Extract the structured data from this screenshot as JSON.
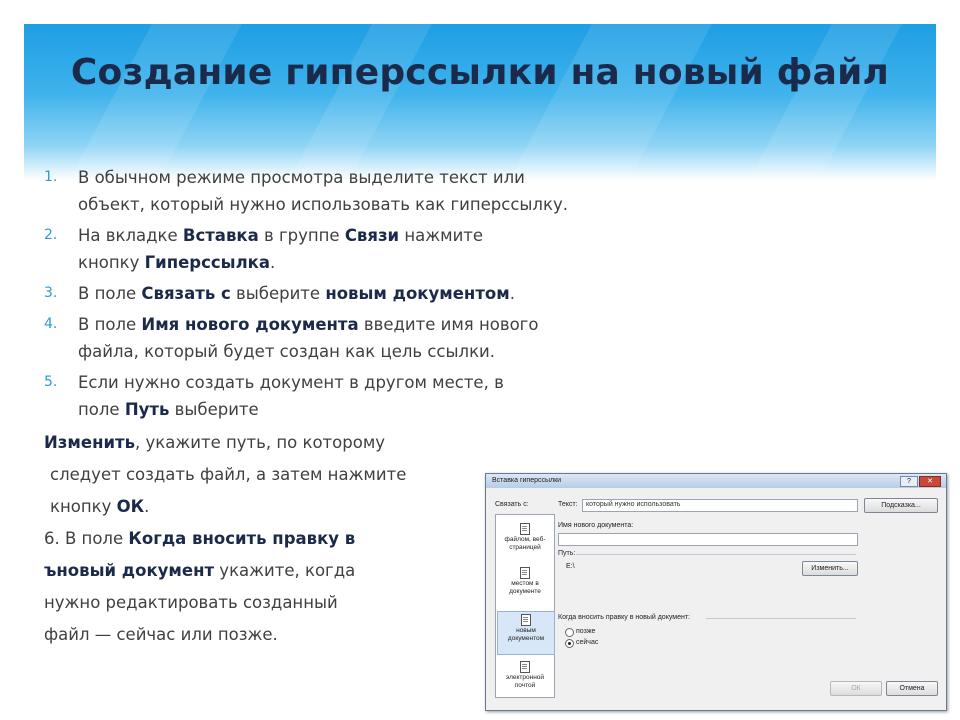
{
  "title": "Создание гиперссылки на новый файл",
  "steps": [
    {
      "num": "1.",
      "line1": "В обычном режиме просмотра выделите текст или",
      "line2": "объект, который нужно использовать как гиперссылку."
    },
    {
      "num": "2.",
      "p1": "На вкладке ",
      "b1": "Вставка",
      "p2": " в группе ",
      "b2": "Связи",
      "p3": " нажмите",
      "l2p": "кнопку ",
      "l2b": "Гиперссылка",
      "l2e": "."
    },
    {
      "num": "3.",
      "p1": "В поле ",
      "b1": "Связать с",
      "p2": " выберите ",
      "b2": "новым документом",
      "p3": "."
    },
    {
      "num": "4.",
      "p1": "В поле ",
      "b1": "Имя нового документа",
      "p2": " введите имя нового",
      "line2": "файла, который будет создан как цель ссылки."
    },
    {
      "num": "5.",
      "line1": "Если нужно создать документ в другом месте, в",
      "l2p": "поле ",
      "l2b": "Путь",
      "l2e": " выберите"
    }
  ],
  "cont": {
    "l1b": "Изменить",
    "l1e": ", укажите путь, по которому",
    "l2": "следует создать файл, а затем нажмите",
    "l3p": "кнопку ",
    "l3b": "ОК",
    "l3e": ".",
    "l4p": "6. В поле ",
    "l4b": "Когда вносить правку в",
    "l5b": "ъновый документ",
    "l5e": " укажите, когда",
    "l6": "нужно редактировать созданный",
    "l7": "файл — сейчас или позже."
  },
  "dialog": {
    "title": "Вставка гиперссылки",
    "help": "?",
    "close": "✕",
    "link_to": "Связать с:",
    "text_label": "Текст:",
    "text_value": "который нужно использовать",
    "tooltip_btn": "Подсказка...",
    "items": [
      "файлом, веб-страницей",
      "местом в документе",
      "новым документом",
      "электронной почтой"
    ],
    "new_doc_name": "Имя нового документа:",
    "path_label": "Путь:",
    "path_value": "E:\\",
    "change_btn": "Изменить...",
    "when_edit": "Когда вносить правку в новый документ:",
    "later": "позже",
    "now": "сейчас",
    "ok": "ОК",
    "cancel": "Отмена"
  }
}
